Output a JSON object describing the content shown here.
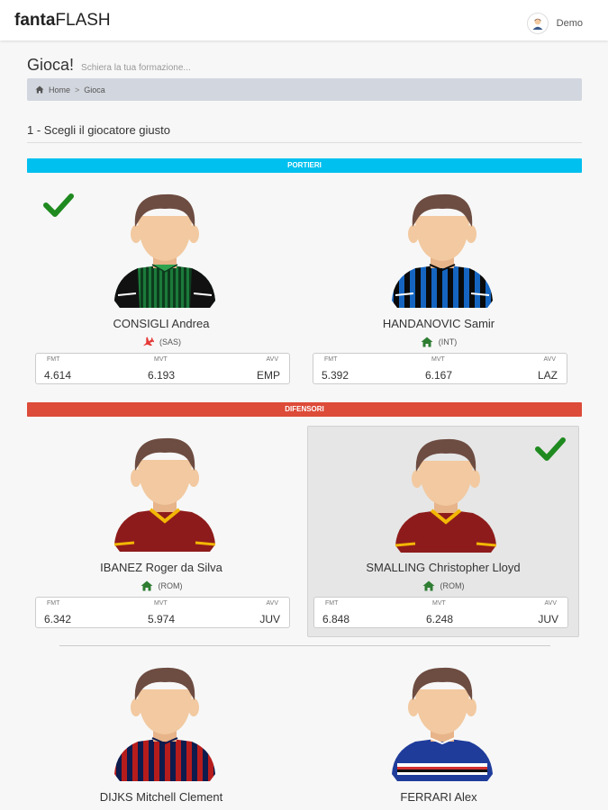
{
  "app": {
    "brand_bold": "fanta",
    "brand_light": "FLASH"
  },
  "user": {
    "name": "Demo",
    "avatar_icon": "user-avatar-icon"
  },
  "page": {
    "title": "Gioca!",
    "subtitle": "Schiera la tua formazione..."
  },
  "breadcrumb": {
    "home_icon": "home-icon",
    "home": "Home",
    "separator": ">",
    "current": "Gioca"
  },
  "section": {
    "heading": "1 - Scegli il giocatore giusto"
  },
  "groups": {
    "goalkeepers": {
      "label": "PORTIERI",
      "color": "#00c0ef"
    },
    "defenders": {
      "label": "DIFENSORI",
      "color": "#dd4b39"
    }
  },
  "stat_labels": {
    "fmt": "FMT",
    "mvt": "MVT",
    "avv": "AVV"
  },
  "players": [
    {
      "name": "CONSIGLI Andrea",
      "team": "(SAS)",
      "venue_icon": "airplane-icon",
      "fmt": "4.614",
      "mvt": "6.193",
      "avv": "EMP",
      "checked": true,
      "kit": "sassuolo"
    },
    {
      "name": "HANDANOVIC Samir",
      "team": "(INT)",
      "venue_icon": "home-icon",
      "fmt": "5.392",
      "mvt": "6.167",
      "avv": "LAZ",
      "checked": false,
      "kit": "inter"
    },
    {
      "name": "IBANEZ Roger da Silva",
      "team": "(ROM)",
      "venue_icon": "home-icon",
      "fmt": "6.342",
      "mvt": "5.974",
      "avv": "JUV",
      "checked": false,
      "kit": "roma"
    },
    {
      "name": "SMALLING Christopher Lloyd",
      "team": "(ROM)",
      "venue_icon": "home-icon",
      "fmt": "6.848",
      "mvt": "6.248",
      "avv": "JUV",
      "checked": true,
      "selected": true,
      "kit": "roma"
    },
    {
      "name": "DIJKS Mitchell Clement",
      "kit": "bologna"
    },
    {
      "name": "FERRARI Alex",
      "kit": "sampdoria"
    }
  ],
  "colors": {
    "check": "#1f8a1f",
    "home": "#2e7d32",
    "away": "#e53935"
  }
}
